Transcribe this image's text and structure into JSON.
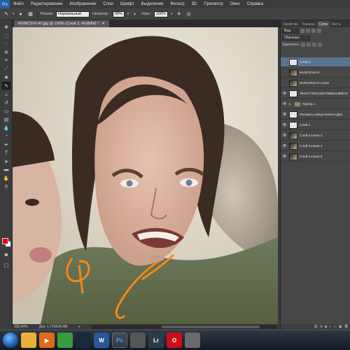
{
  "app": {
    "logo": "Ps"
  },
  "menu": [
    "Файл",
    "Редактирование",
    "Изображение",
    "Слои",
    "Шрифт",
    "Выделение",
    "Фильтр",
    "3D",
    "Просмотр",
    "Окно",
    "Справка"
  ],
  "options": {
    "mode_label": "Режим:",
    "mode_value": "Нормальный",
    "opacity_label": "Непрозр.:",
    "opacity_value": "99%",
    "flow_label": "Наж.:",
    "flow_value": "100%"
  },
  "document": {
    "tab_label": "MVNCDVIc4Y.jpg @ 100% (Слой 2, RGB/8#) *",
    "zoom": "100,44%",
    "doc_info": "Док: 1,72М/34,4М"
  },
  "colors": {
    "foreground": "#e2000c",
    "background": "#ffffff",
    "selection": "#5b7591"
  },
  "panels": {
    "tabs": [
      "Свойства",
      "Каналы",
      "Слои",
      "Кисть"
    ],
    "active_tab": "Слои",
    "kind_filter": "Вид",
    "blend_mode": "Обычные",
    "lock_label": "Закрепить:",
    "layers": [
      {
        "name": "Слой 2",
        "thumb": "transp",
        "selected": true,
        "visible": false
      },
      {
        "name": "MVNCDVIc4Y",
        "thumb": "photo",
        "selected": false,
        "visible": false
      },
      {
        "name": "MVNCDVIc4Y копия",
        "thumb": "photo",
        "selected": false,
        "visible": false
      },
      {
        "name": "7b434770021ab57559911388b76",
        "thumb": "transp",
        "selected": false,
        "visible": true
      },
      {
        "name": "Группа 1",
        "thumb": "folder",
        "selected": false,
        "visible": true
      },
      {
        "name": "Рисовать-nabуa-orehom-glaz",
        "thumb": "transp",
        "selected": false,
        "visible": true
      },
      {
        "name": "Слой 1",
        "thumb": "transp",
        "selected": false,
        "visible": true
      },
      {
        "name": "Слой 0 копия 3",
        "thumb": "photo",
        "selected": false,
        "visible": true
      },
      {
        "name": "Слой 0 копия 4",
        "thumb": "photo",
        "selected": false,
        "visible": true
      },
      {
        "name": "Слой 0 копия 5",
        "thumb": "photo",
        "selected": false,
        "visible": true
      }
    ]
  },
  "tools": [
    "move-icon",
    "marquee-icon",
    "lasso-icon",
    "quick-select-icon",
    "crop-icon",
    "eyedropper-icon",
    "healing-icon",
    "brush-icon",
    "clone-stamp-icon",
    "history-brush-icon",
    "eraser-icon",
    "gradient-icon",
    "blur-icon",
    "dodge-icon",
    "pen-icon",
    "type-icon",
    "path-select-icon",
    "shape-icon",
    "hand-icon",
    "zoom-icon"
  ],
  "taskbar": {
    "apps": [
      {
        "name": "explorer",
        "label": "",
        "color": "#e8b13a",
        "open": false
      },
      {
        "name": "media-player",
        "label": "▶",
        "color": "#e06a1a",
        "open": false
      },
      {
        "name": "chrome",
        "label": "",
        "color": "#3b9b3f",
        "open": false
      },
      {
        "name": "steam",
        "label": "",
        "color": "#1b2838",
        "open": false
      },
      {
        "name": "word",
        "label": "W",
        "color": "#2b5797",
        "open": false
      },
      {
        "name": "photoshop",
        "label": "Ps",
        "color": "#0f2a45",
        "open": true
      },
      {
        "name": "misc",
        "label": "",
        "color": "#555",
        "open": false
      },
      {
        "name": "lightroom",
        "label": "Lr",
        "color": "#2a3b4a",
        "open": false
      },
      {
        "name": "opera",
        "label": "O",
        "color": "#cc0f16",
        "open": false
      },
      {
        "name": "generic",
        "label": "",
        "color": "#6a6a6a",
        "open": false
      }
    ]
  }
}
